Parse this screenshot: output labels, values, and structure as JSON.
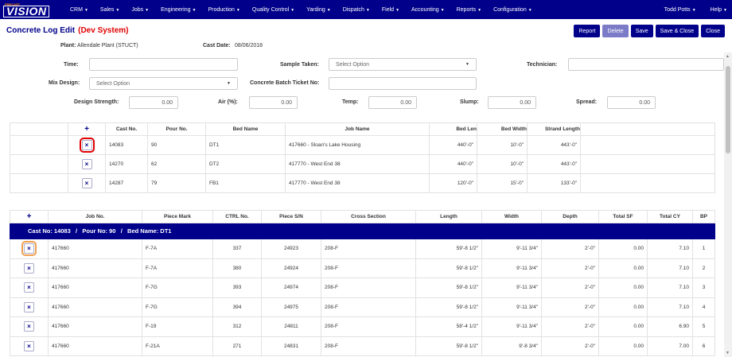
{
  "nav": {
    "logo_top": "PRECAST",
    "logo_main": "VISION",
    "menu": [
      "CRM",
      "Sales",
      "Jobs",
      "Engineering",
      "Production",
      "Quality Control",
      "Yarding",
      "Dispatch",
      "Field",
      "Accounting",
      "Reports",
      "Configuration"
    ],
    "user": "Todd Potts",
    "help": "Help"
  },
  "page": {
    "title": "Concrete Log Edit",
    "env": "(Dev System)"
  },
  "buttons": {
    "report": "Report",
    "delete": "Delete",
    "save": "Save",
    "save_close": "Save & Close",
    "close": "Close"
  },
  "header": {
    "plant_label": "Plant:",
    "plant_value": "Allendale Plant (STUCT)",
    "cast_date_label": "Cast Date:",
    "cast_date_value": "08/06/2018"
  },
  "form": {
    "time_label": "Time:",
    "time_value": "",
    "sample_taken_label": "Sample Taken:",
    "sample_taken_value": "Select Option",
    "technician_label": "Technician:",
    "technician_value": "",
    "mix_design_label": "Mix Design:",
    "mix_design_value": "Select Option",
    "batch_ticket_label": "Concrete Batch Ticket No:",
    "batch_ticket_value": "",
    "design_strength_label": "Design Strength:",
    "design_strength_value": "0.00",
    "air_label": "Air (%):",
    "air_value": "0.00",
    "temp_label": "Temp:",
    "temp_value": "0.00",
    "slump_label": "Slump:",
    "slump_value": "0.00",
    "spread_label": "Spread:",
    "spread_value": "0.00"
  },
  "beds": {
    "headers": [
      "+",
      "Cast No.",
      "Pour No.",
      "Bed Name",
      "Job Name",
      "Bed Len",
      "Bed Width",
      "Strand Length"
    ],
    "rows": [
      [
        "14083",
        "90",
        "DT1",
        "417660 - Sloan's Lake Housing",
        "440'-0\"",
        "10'-0\"",
        "443'-0\""
      ],
      [
        "14270",
        "62",
        "DT2",
        "417770 - West End 38",
        "440'-0\"",
        "10'-0\"",
        "443'-0\""
      ],
      [
        "14287",
        "79",
        "FB1",
        "417770 - West End 38",
        "120'-0\"",
        "15'-0\"",
        "133'-0\""
      ]
    ]
  },
  "pieces": {
    "headers": [
      "+",
      "Job No.",
      "Piece Mark",
      "CTRL No.",
      "Piece S/N",
      "Cross Section",
      "Length",
      "Width",
      "Depth",
      "Total SF",
      "Total CY",
      "BP"
    ],
    "group_label": "Cast No: 14083   /   Pour No: 90   /   Bed Name: DT1",
    "rows": [
      [
        "417660",
        "F-7A",
        "337",
        "24923",
        "208-F",
        "59'-8 1/2\"",
        "9'-11 3/4\"",
        "2'-0\"",
        "0.00",
        "7.10",
        "1"
      ],
      [
        "417660",
        "F-7A",
        "380",
        "24924",
        "208-F",
        "59'-8 1/2\"",
        "9'-11 3/4\"",
        "2'-0\"",
        "0.00",
        "7.10",
        "2"
      ],
      [
        "417660",
        "F-7G",
        "393",
        "24974",
        "208-F",
        "59'-8 1/2\"",
        "9'-11 3/4\"",
        "2'-0\"",
        "0.00",
        "7.10",
        "3"
      ],
      [
        "417660",
        "F-7G",
        "394",
        "24975",
        "208-F",
        "59'-8 1/2\"",
        "9'-11 3/4\"",
        "2'-0\"",
        "0.00",
        "7.10",
        "4"
      ],
      [
        "417660",
        "F-19",
        "312",
        "24811",
        "208-F",
        "58'-4 1/2\"",
        "9'-11 3/4\"",
        "2'-0\"",
        "0.00",
        "6.90",
        "5"
      ],
      [
        "417660",
        "F-21A",
        "271",
        "24831",
        "208-F",
        "59'-8 1/2\"",
        "9'-8 3/4\"",
        "2'-0\"",
        "0.00",
        "7.00",
        "6"
      ]
    ]
  }
}
